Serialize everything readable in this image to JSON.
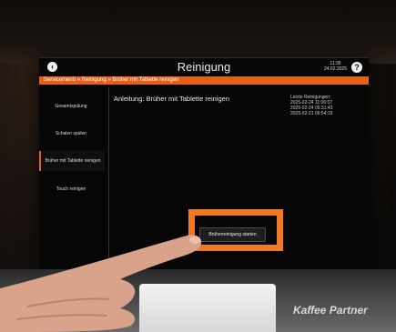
{
  "screen": {
    "title": "Reinigung",
    "time": "11:35",
    "date": "24.02.2025",
    "back_icon": "‹",
    "help_icon": "?",
    "breadcrumb": "Servicemenü » Reinigung » Brüher mit Tablette reinigen"
  },
  "sidebar": {
    "items": [
      {
        "label": "Gesamtspülung",
        "active": false
      },
      {
        "label": "Schalen spülen",
        "active": false
      },
      {
        "label": "Brüher mit Tablette reinigen",
        "active": true
      },
      {
        "label": "Touch reinigen",
        "active": false
      }
    ]
  },
  "main": {
    "instruction": "Anleitung: Brüher mit Tablette reinigen",
    "history_title": "Letzte Reinigungen:",
    "history": [
      "2025-02-24 11:06:07",
      "2025-02-24 05:31:43",
      "2025-02-21 06:54:19"
    ],
    "start_button": "Brüherreinigung starten"
  },
  "brand": "Kaffee Partner",
  "colors": {
    "accent": "#e55f1a",
    "highlight": "#f07a23"
  }
}
